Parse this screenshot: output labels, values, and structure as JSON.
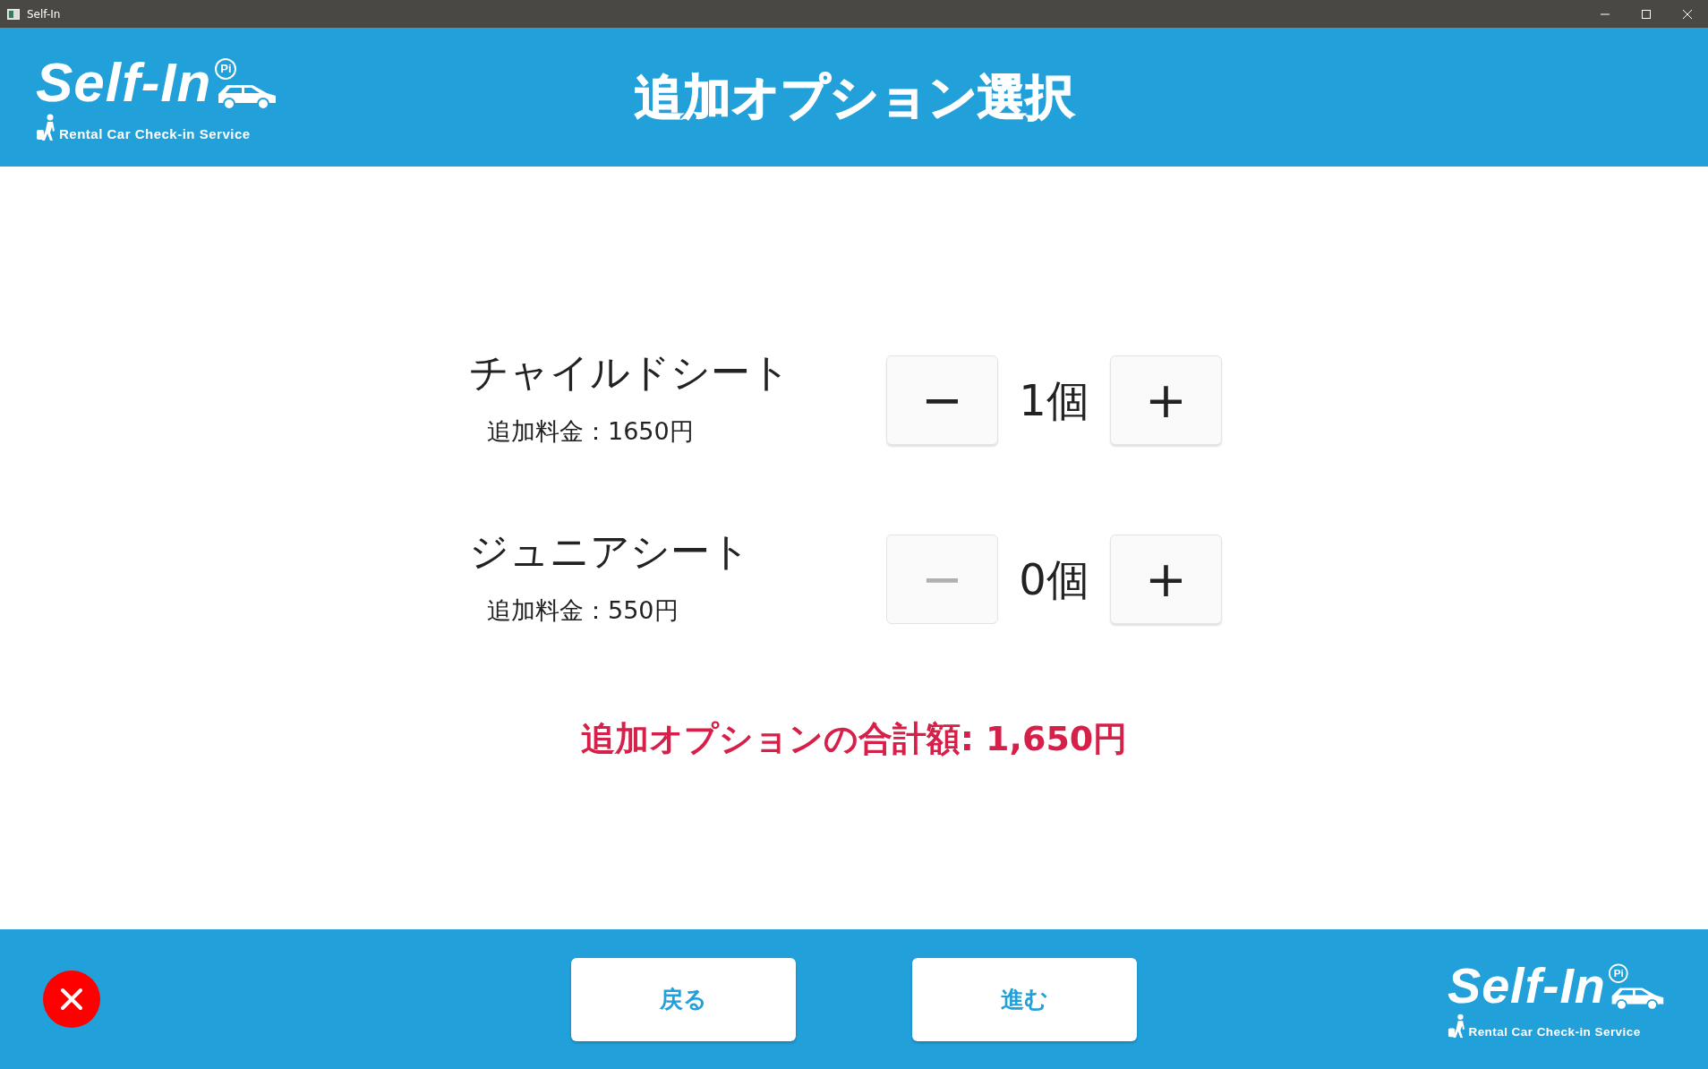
{
  "window": {
    "title": "Self-In"
  },
  "header": {
    "logo": {
      "wordmark": "Self-In",
      "badge": "Pi",
      "tagline": "Rental Car Check-in Service"
    },
    "title": "追加オプション選択"
  },
  "options": [
    {
      "name": "チャイルドシート",
      "price": "追加料金：1650円",
      "minus": "−",
      "plus": "+",
      "quantity": "1個",
      "minus_disabled": false
    },
    {
      "name": "ジュニアシート",
      "price": "追加料金：550円",
      "minus": "−",
      "plus": "+",
      "quantity": "0個",
      "minus_disabled": true
    }
  ],
  "total": "追加オプションの合計額: 1,650円",
  "footer": {
    "buttons": [
      {
        "label": "戻る"
      },
      {
        "label": "進む"
      }
    ],
    "logo": {
      "wordmark": "Self-In",
      "badge": "Pi",
      "tagline": "Rental Car Check-in Service"
    }
  }
}
